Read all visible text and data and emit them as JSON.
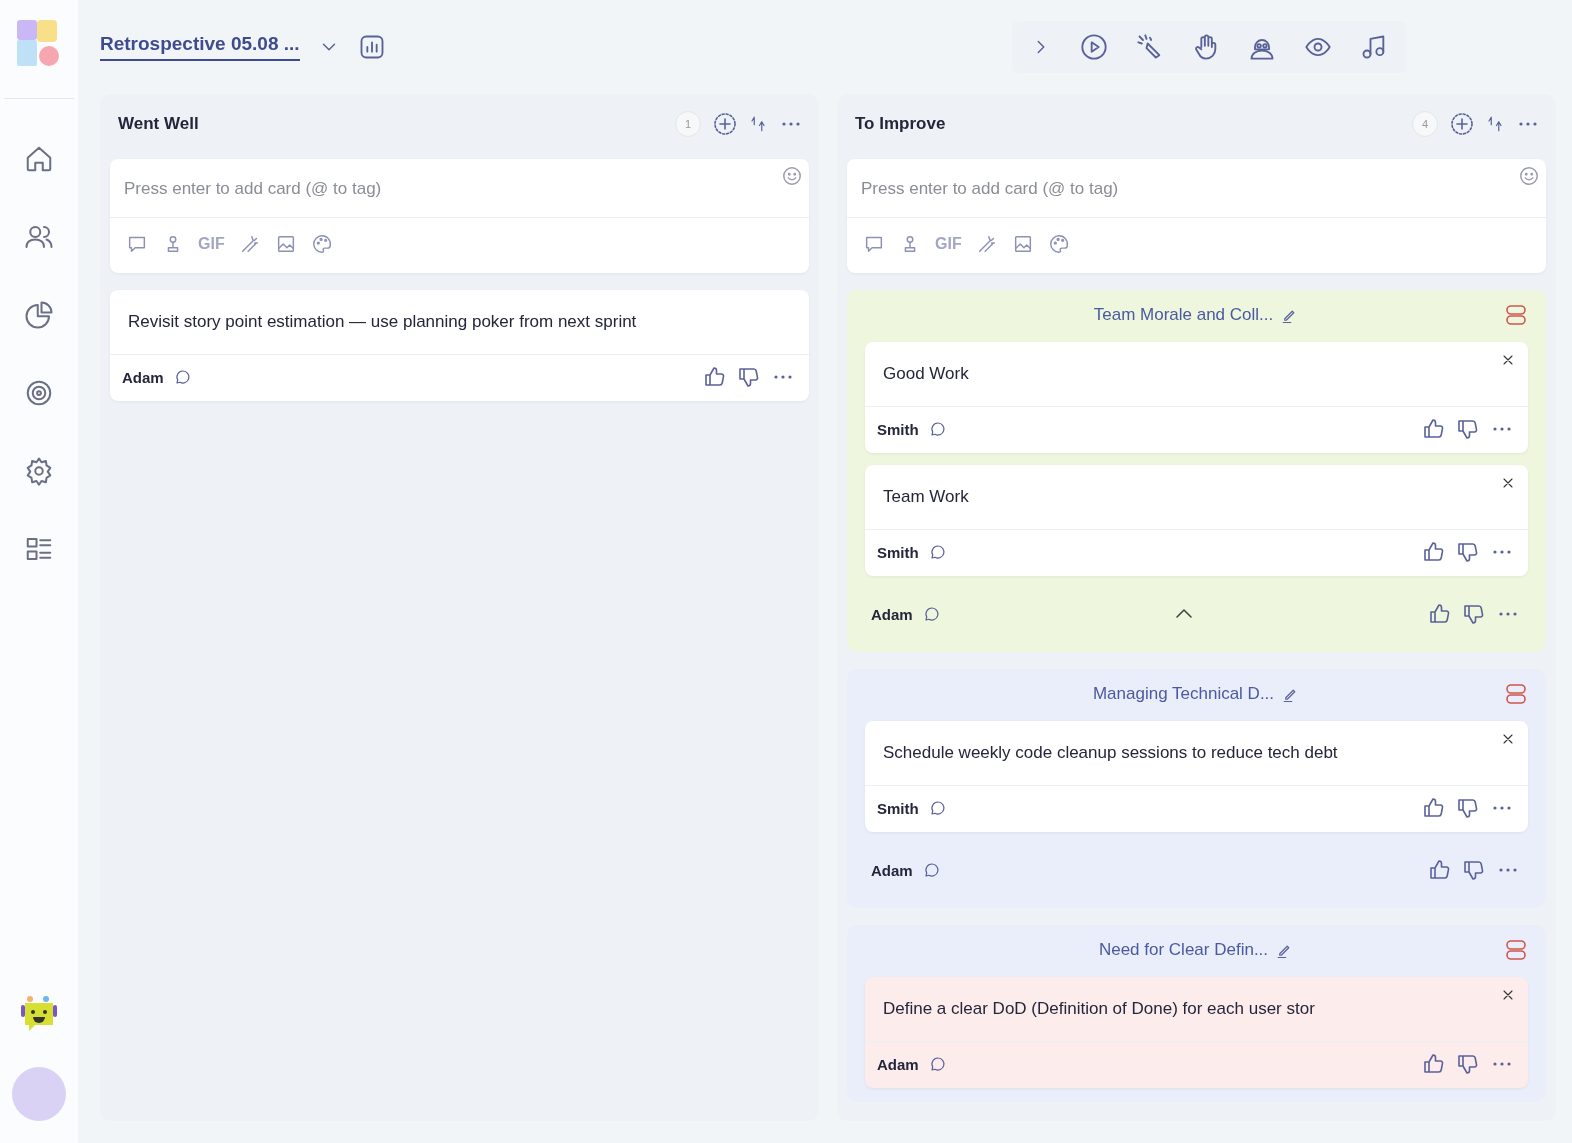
{
  "board": {
    "title": "Retrospective 05.08 ..."
  },
  "columns": [
    {
      "title": "Went Well",
      "count": "1",
      "input": {
        "placeholder": "Press enter to add card (@ to tag)"
      },
      "gif": "GIF",
      "items": [
        {
          "kind": "card",
          "text": "Revisit story point estimation — use planning poker from next sprint",
          "author": "Adam",
          "color": "#ffffff"
        }
      ]
    },
    {
      "title": "To Improve",
      "count": "4",
      "input": {
        "placeholder": "Press enter to add card (@ to tag)"
      },
      "gif": "GIF",
      "items": [
        {
          "kind": "group",
          "title": "Team Morale and Coll...",
          "color": "#eef7dd",
          "expanded": true,
          "author": "Adam",
          "cards": [
            {
              "text": "Good Work",
              "author": "Smith",
              "color": "#ffffff"
            },
            {
              "text": "Team Work",
              "author": "Smith",
              "color": "#ffffff"
            }
          ]
        },
        {
          "kind": "group",
          "title": "Managing Technical D...",
          "color": "#eaeefa",
          "expanded": false,
          "author": "Adam",
          "cards": [
            {
              "text": "Schedule weekly code cleanup sessions to reduce tech debt",
              "author": "Smith",
              "color": "#ffffff"
            }
          ]
        },
        {
          "kind": "group",
          "title": "Need for Clear Defin...",
          "color": "#eaeefa",
          "cards": [
            {
              "text": "Define a clear DoD (Definition of Done) for each user stor",
              "author": "Adam",
              "color": "#fdecec"
            }
          ]
        }
      ]
    }
  ]
}
